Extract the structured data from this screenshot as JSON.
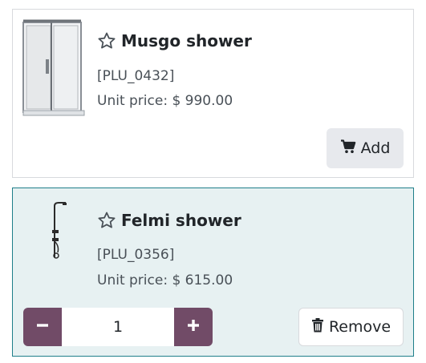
{
  "products": [
    {
      "name": "Musgo shower",
      "reference": "[PLU_0432]",
      "price": "Unit price: $ 990.00",
      "action_label": "Add"
    },
    {
      "name": "Felmi shower",
      "reference": "[PLU_0356]",
      "price": "Unit price: $ 615.00",
      "quantity": "1",
      "action_label": "Remove"
    }
  ],
  "icons": {
    "favorite": "star-outline-icon",
    "cart": "shopping-cart-icon",
    "minus": "minus-icon",
    "plus": "plus-icon",
    "trash": "trash-icon"
  },
  "colors": {
    "accent": "#714b67",
    "selected_bg": "#e7f1f2",
    "selected_border": "#1f7f8a",
    "add_button_bg": "#e7e9ed"
  }
}
